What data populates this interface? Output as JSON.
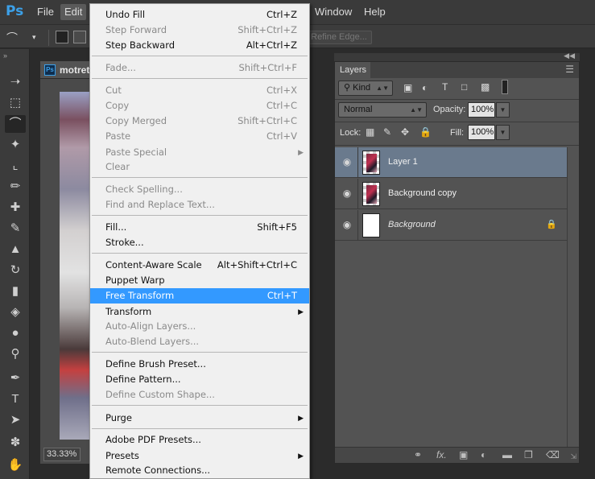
{
  "menubar": {
    "logo": "Ps",
    "items": {
      "file": "File",
      "edit": "Edit",
      "window": "Window",
      "help": "Help"
    }
  },
  "options_bar": {
    "refine_edge": "Refine Edge..."
  },
  "document": {
    "badge": "Ps",
    "title": "motret",
    "zoom": "33.33%"
  },
  "edit_menu": {
    "undo_fill": {
      "label": "Undo Fill",
      "shortcut": "Ctrl+Z"
    },
    "step_forward": {
      "label": "Step Forward",
      "shortcut": "Shift+Ctrl+Z"
    },
    "step_backward": {
      "label": "Step Backward",
      "shortcut": "Alt+Ctrl+Z"
    },
    "fade": {
      "label": "Fade...",
      "shortcut": "Shift+Ctrl+F"
    },
    "cut": {
      "label": "Cut",
      "shortcut": "Ctrl+X"
    },
    "copy": {
      "label": "Copy",
      "shortcut": "Ctrl+C"
    },
    "copy_merged": {
      "label": "Copy Merged",
      "shortcut": "Shift+Ctrl+C"
    },
    "paste": {
      "label": "Paste",
      "shortcut": "Ctrl+V"
    },
    "paste_special": {
      "label": "Paste Special"
    },
    "clear": {
      "label": "Clear"
    },
    "check_spelling": {
      "label": "Check Spelling..."
    },
    "find_replace": {
      "label": "Find and Replace Text..."
    },
    "fill": {
      "label": "Fill...",
      "shortcut": "Shift+F5"
    },
    "stroke": {
      "label": "Stroke..."
    },
    "content_aware_scale": {
      "label": "Content-Aware Scale",
      "shortcut": "Alt+Shift+Ctrl+C"
    },
    "puppet_warp": {
      "label": "Puppet Warp"
    },
    "free_transform": {
      "label": "Free Transform",
      "shortcut": "Ctrl+T"
    },
    "transform": {
      "label": "Transform"
    },
    "auto_align": {
      "label": "Auto-Align Layers..."
    },
    "auto_blend": {
      "label": "Auto-Blend Layers..."
    },
    "define_brush": {
      "label": "Define Brush Preset..."
    },
    "define_pattern": {
      "label": "Define Pattern..."
    },
    "define_shape": {
      "label": "Define Custom Shape..."
    },
    "purge": {
      "label": "Purge"
    },
    "pdf_presets": {
      "label": "Adobe PDF Presets..."
    },
    "presets": {
      "label": "Presets"
    },
    "remote_connections": {
      "label": "Remote Connections..."
    }
  },
  "layers_panel": {
    "tab": "Layers",
    "filter_kind": "Kind",
    "blend_mode": "Normal",
    "opacity_label": "Opacity:",
    "opacity_value": "100%",
    "lock_label": "Lock:",
    "fill_label": "Fill:",
    "fill_value": "100%",
    "layers": [
      {
        "name": "Layer 1"
      },
      {
        "name": "Background copy"
      },
      {
        "name": "Background"
      }
    ],
    "footer_fx": "fx."
  },
  "colors": {
    "highlight": "#3399ff",
    "selected_layer": "#6a7a8d",
    "ps_blue": "#3ca0e8"
  }
}
